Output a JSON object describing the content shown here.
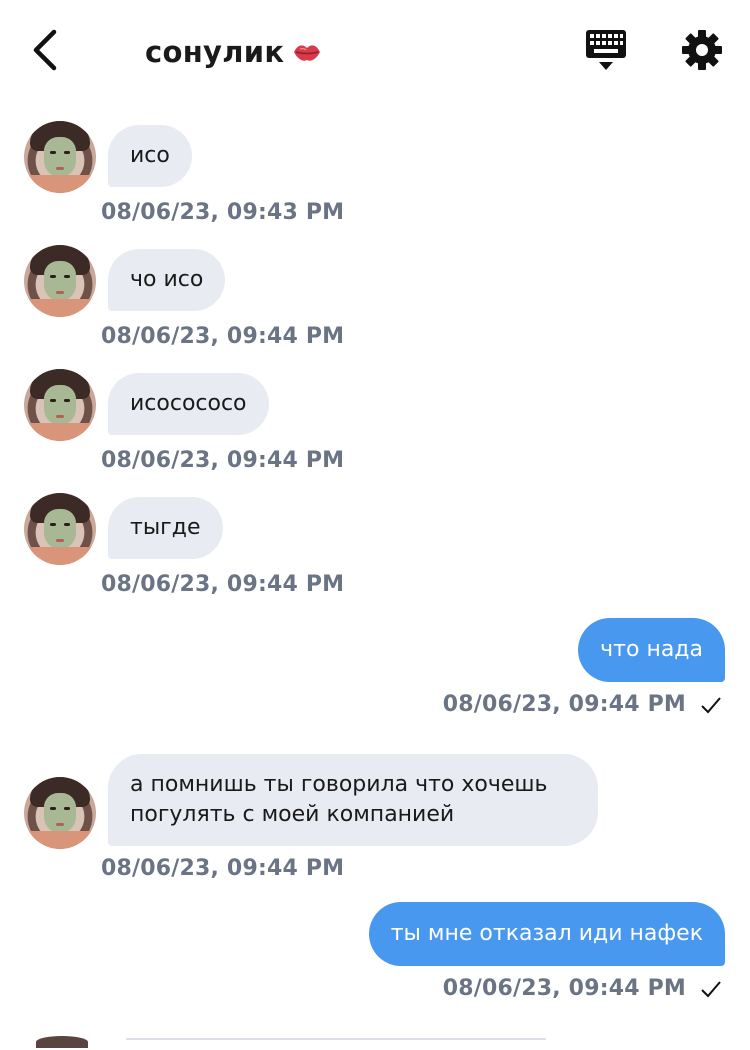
{
  "header": {
    "title": "сонулик",
    "title_emoji": "kiss-lips-emoji",
    "back_icon": "chevron-left-icon",
    "keyboard_icon": "keyboard-icon",
    "settings_icon": "gear-icon"
  },
  "messages": [
    {
      "direction": "in",
      "text": "исо",
      "time": "08/06/23, 09:43 PM"
    },
    {
      "direction": "in",
      "text": "чо исо",
      "time": "08/06/23, 09:44 PM"
    },
    {
      "direction": "in",
      "text": "исосососо",
      "time": "08/06/23, 09:44 PM"
    },
    {
      "direction": "in",
      "text": "тыгде",
      "time": "08/06/23, 09:44 PM"
    },
    {
      "direction": "out",
      "text": "что нада",
      "time": "08/06/23, 09:44 PM"
    },
    {
      "direction": "in",
      "text_line1": "а помнишь ты говорила что хочешь",
      "text_line2": "погулять с моей компанией",
      "time": "08/06/23, 09:44 PM"
    },
    {
      "direction": "out",
      "text": "ты мне отказал иди нафек",
      "time": "08/06/23, 09:44 PM"
    }
  ],
  "colors": {
    "incoming_bubble": "#e9ebf2",
    "outgoing_bubble": "#4998f0",
    "timestamp": "#6b7484"
  }
}
